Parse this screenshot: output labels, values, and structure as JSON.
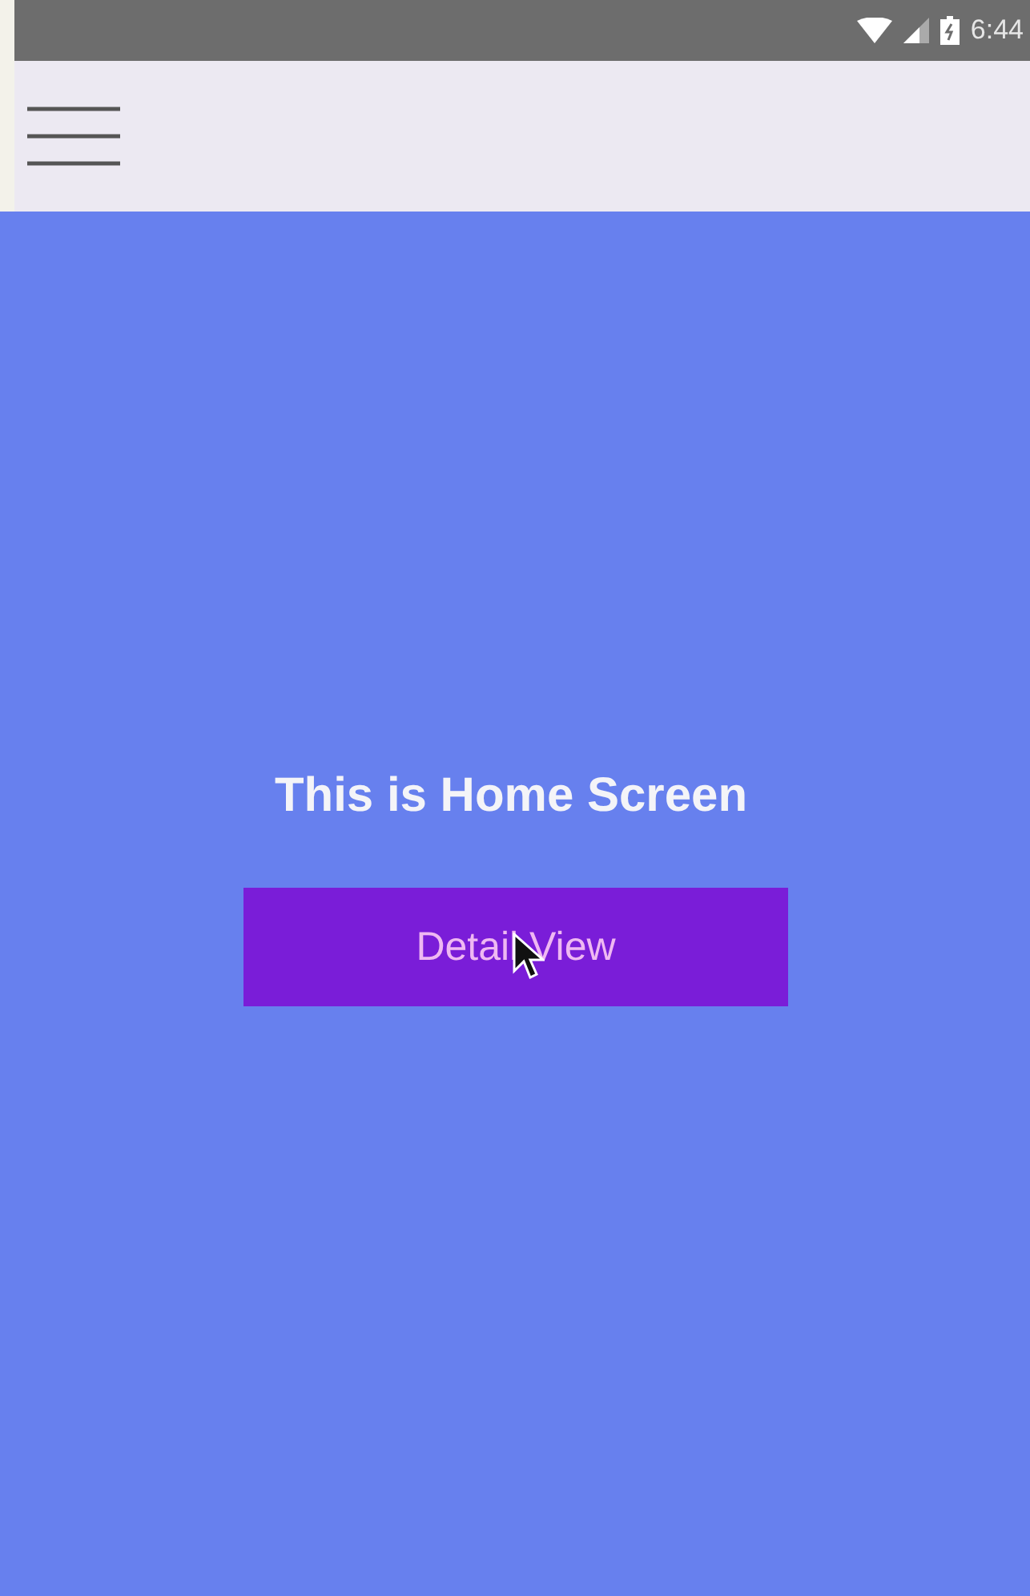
{
  "status_bar": {
    "time": "6:44"
  },
  "home": {
    "title": "This is Home Screen",
    "button": "Detail View"
  }
}
